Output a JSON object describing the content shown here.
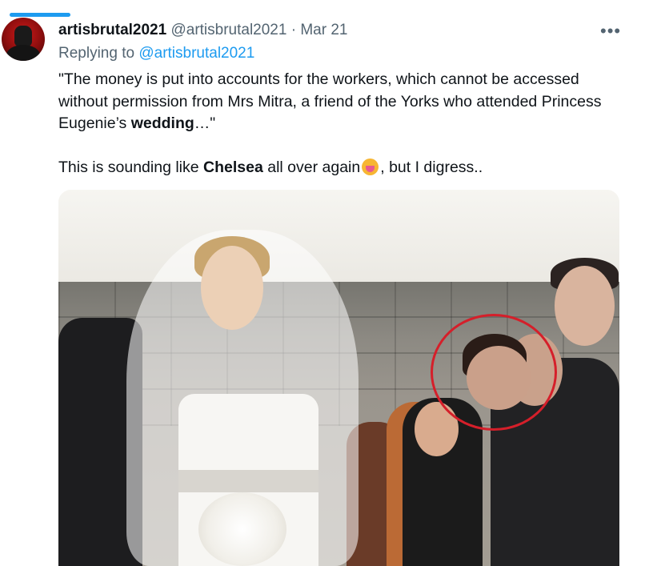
{
  "tweet": {
    "author_name": "artisbrutal2021",
    "author_handle": "@artisbrutal2021",
    "separator": "·",
    "date": "Mar 21",
    "more_label": "•••",
    "replying_prefix": "Replying to",
    "replying_handle": "@artisbrutal2021",
    "quote_part1": "\"The money is put into accounts for the workers, which cannot be accessed without permission from Mrs Mitra, a friend of the Yorks who attended Princess Eugenie’s ",
    "quote_bold": "wedding",
    "quote_part2": "…\"",
    "line2_part1": "This is sounding like ",
    "line2_bold": "Chelsea",
    "line2_part2": " all over again",
    "line2_part3": ", but I digress.."
  },
  "icons": {
    "emoji": "woman-facepalming-icon",
    "more": "more-icon"
  },
  "colors": {
    "accent": "#1d9bf0",
    "secondary_text": "#536471",
    "highlight_circle": "#d51f2a"
  }
}
